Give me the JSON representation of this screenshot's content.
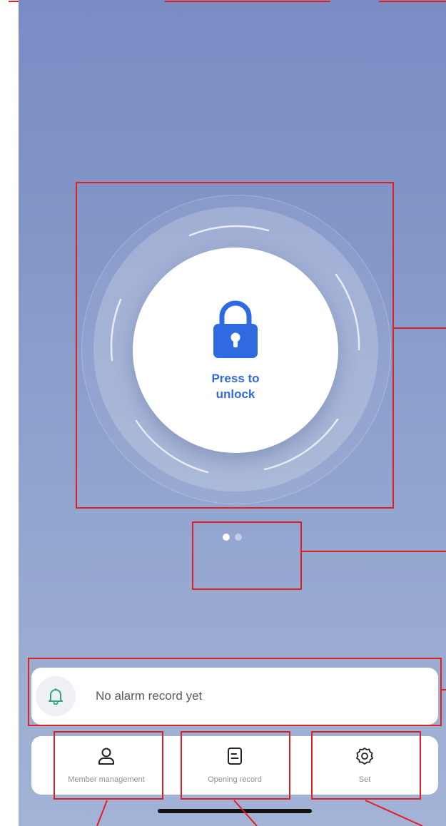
{
  "lock": {
    "label": "Press to\nunlock",
    "icon": "padlock-icon",
    "accent_color": "#2f6ae0"
  },
  "pager": {
    "count": 2,
    "active_index": 0
  },
  "alarm": {
    "icon": "bell-icon",
    "text": "No alarm record yet"
  },
  "nav": {
    "items": [
      {
        "label": "Member management",
        "icon": "person-icon"
      },
      {
        "label": "Opening record",
        "icon": "document-icon"
      },
      {
        "label": "Set",
        "icon": "gear-icon"
      }
    ]
  }
}
